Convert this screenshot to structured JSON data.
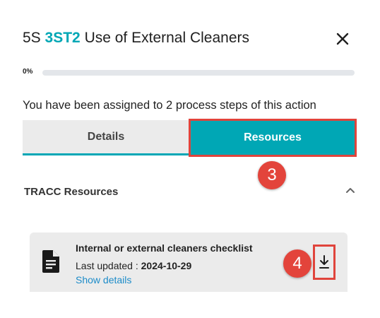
{
  "dialog": {
    "title_prefix": "5S",
    "title_code": "3ST2",
    "title_text": "Use of External Cleaners"
  },
  "progress": {
    "label": "0%",
    "value_percent": 0
  },
  "assignment_text": "You have been assigned to 2 process steps of this action",
  "tabs": [
    {
      "label": "Details",
      "active": false
    },
    {
      "label": "Resources",
      "active": true
    }
  ],
  "resources": {
    "section_title": "TRACC Resources",
    "items": [
      {
        "name": "Internal or external cleaners checklist",
        "updated_label": "Last updated :",
        "updated_date": "2024-10-29",
        "details_link": "Show details",
        "icon": "document-icon"
      }
    ]
  },
  "callouts": [
    "3",
    "4"
  ],
  "colors": {
    "accent": "#00a7b5",
    "highlight": "#e0443c",
    "link": "#1d8cc9"
  },
  "icons": {
    "close": "close-icon",
    "collapse": "chevron-up-icon",
    "download": "download-icon"
  }
}
